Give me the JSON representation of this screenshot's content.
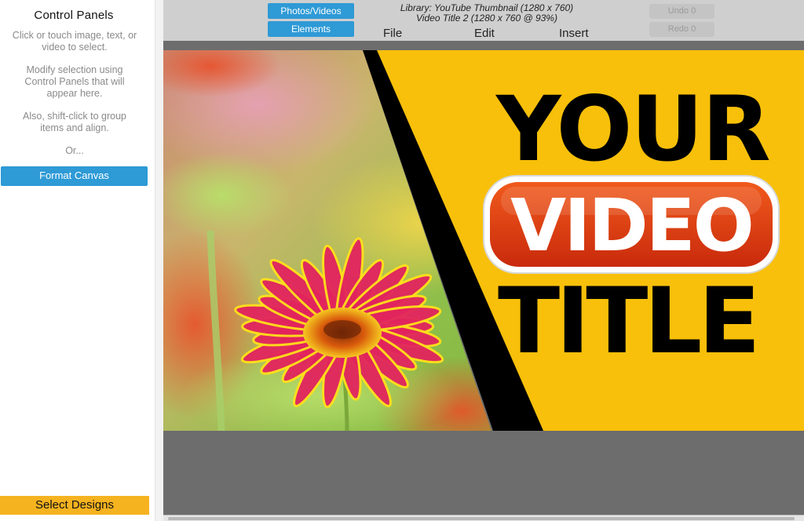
{
  "control_panel": {
    "title": "Control Panels",
    "hint_select": "Click or touch image, text, or video to select.",
    "hint_modify": "Modify selection using Control Panels that will appear here.",
    "hint_group": "Also, shift-click to group items and align.",
    "or_label": "Or...",
    "format_canvas_label": "Format Canvas",
    "select_designs_label": "Select Designs"
  },
  "toolbar": {
    "photos_videos_label": "Photos/Videos",
    "elements_label": "Elements",
    "library_line": "Library: YouTube Thumbnail (1280 x 760)",
    "project_line": "Video Title 2 (1280 x 760 @ 93%)",
    "menu": {
      "file": "File",
      "edit": "Edit",
      "insert": "Insert"
    },
    "undo_label": "Undo 0",
    "redo_label": "Redo 0"
  },
  "canvas": {
    "headline_top": "YOUR",
    "headline_middle": "VIDEO",
    "headline_bottom": "TITLE",
    "colors": {
      "background": "#f8c00a",
      "slash": "#000000",
      "badge": "#e43a12",
      "badge_border": "#ffffff",
      "flower_petal": "#e2245e",
      "flower_tip": "#ffe01a"
    },
    "image_subject": "flower-photo"
  },
  "colors": {
    "accent_blue": "#2e9ad6",
    "accent_orange": "#f6b320",
    "toolbar_gray": "#cfcfcf",
    "workspace_gray": "#6d6d6d"
  }
}
